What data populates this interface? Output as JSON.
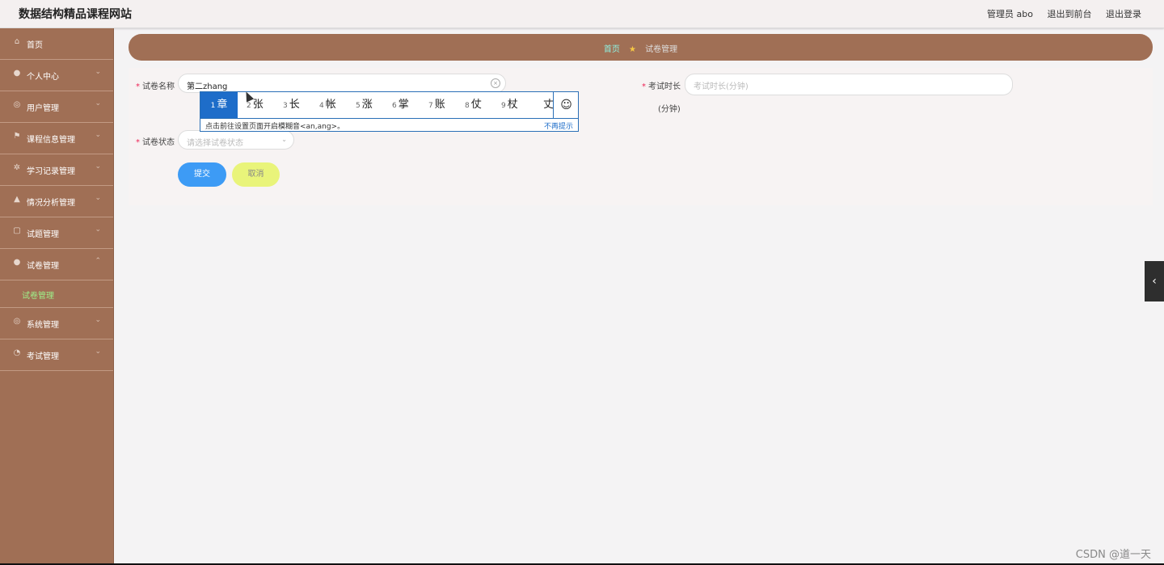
{
  "header": {
    "site_title": "数据结构精品课程网站",
    "user_label": "管理员 abo",
    "back_front_label": "退出到前台",
    "logout_label": "退出登录"
  },
  "sidebar": {
    "items": [
      {
        "label": "首页",
        "icon": "home-icon"
      },
      {
        "label": "个人中心",
        "icon": "user-icon"
      },
      {
        "label": "用户管理",
        "icon": "users-icon"
      },
      {
        "label": "课程信息管理",
        "icon": "flag-icon"
      },
      {
        "label": "学习记录管理",
        "icon": "gear-icon"
      },
      {
        "label": "情况分析管理",
        "icon": "bank-icon"
      },
      {
        "label": "试题管理",
        "icon": "copy-icon"
      },
      {
        "label": "试卷管理",
        "icon": "location-icon",
        "expanded": true
      },
      {
        "label": "系统管理",
        "icon": "settings-icon"
      },
      {
        "label": "考试管理",
        "icon": "compass-icon"
      }
    ],
    "submenu_active": "试卷管理"
  },
  "breadcrumb": {
    "home": "首页",
    "current": "试卷管理"
  },
  "form": {
    "paper_name_label": "试卷名称",
    "paper_name_value": "第二zhang",
    "duration_label": "考试时长",
    "duration_unit": "(分钟)",
    "duration_placeholder": "考试时长(分钟)",
    "status_label": "试卷状态",
    "status_placeholder": "请选择试卷状态",
    "submit_label": "提交",
    "cancel_label": "取消"
  },
  "ime": {
    "candidates": [
      {
        "num": "1",
        "text": "章"
      },
      {
        "num": "2",
        "text": "张"
      },
      {
        "num": "3",
        "text": "长"
      },
      {
        "num": "4",
        "text": "帐"
      },
      {
        "num": "5",
        "text": "涨"
      },
      {
        "num": "6",
        "text": "掌"
      },
      {
        "num": "7",
        "text": "账"
      },
      {
        "num": "8",
        "text": "仗"
      },
      {
        "num": "9",
        "text": "杖"
      },
      {
        "num": "",
        "text": "丈"
      }
    ],
    "hint": "点击前往设置页面开启模糊音<an,ang>。",
    "dismiss": "不再提示",
    "emoji": "☺"
  },
  "side_tab": "‹",
  "watermark": "CSDN @道一天",
  "colors": {
    "sidebar": "#a06f55",
    "breadcrumb_bar": "#a06f55",
    "submit": "#3d9bf5",
    "cancel": "#e9f47a",
    "active_submenu": "#9ef08a"
  }
}
